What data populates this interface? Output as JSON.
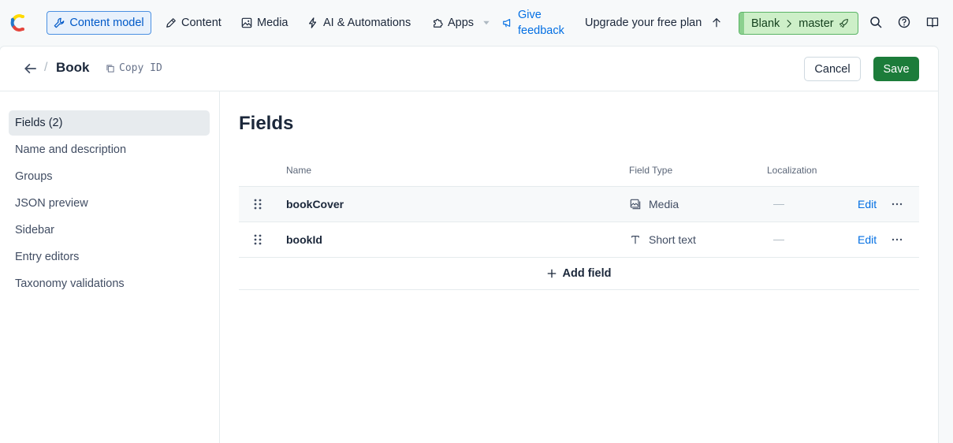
{
  "nav": {
    "content_model": "Content model",
    "content": "Content",
    "media": "Media",
    "ai": "AI & Automations",
    "apps": "Apps",
    "feedback_line1": "Give",
    "feedback_line2": "feedback",
    "upgrade": "Upgrade your free plan",
    "env_space": "Blank",
    "env_name": "master"
  },
  "header": {
    "title": "Book",
    "copy_id": "Copy ID",
    "cancel": "Cancel",
    "save": "Save"
  },
  "sidebar": {
    "items": [
      {
        "label": "Fields (2)",
        "active": true
      },
      {
        "label": "Name and description"
      },
      {
        "label": "Groups"
      },
      {
        "label": "JSON preview"
      },
      {
        "label": "Sidebar"
      },
      {
        "label": "Entry editors"
      },
      {
        "label": "Taxonomy validations"
      }
    ]
  },
  "fields": {
    "title": "Fields",
    "columns": {
      "name": "Name",
      "type": "Field Type",
      "localization": "Localization"
    },
    "rows": [
      {
        "name": "bookCover",
        "type": "Media",
        "type_icon": "media-icon",
        "localization": "—",
        "action": "Edit"
      },
      {
        "name": "bookId",
        "type": "Short text",
        "type_icon": "text-icon",
        "localization": "—",
        "action": "Edit"
      }
    ],
    "add_label": "Add field"
  },
  "colors": {
    "accent": "#036fe3",
    "save_bg": "#1c7c3a",
    "env_bg": "#cdefc8"
  }
}
